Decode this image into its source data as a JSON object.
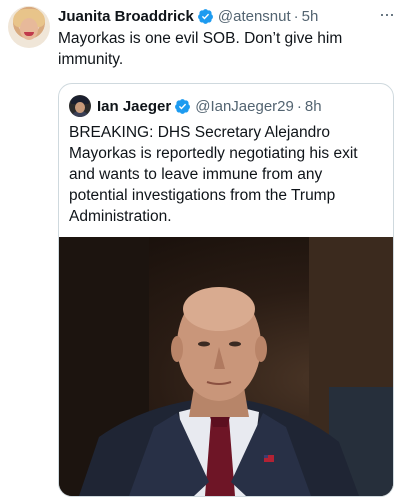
{
  "tweet": {
    "author_name": "Juanita Broaddrick",
    "author_handle": "@atensnut",
    "separator": "·",
    "time": "5h",
    "more": "···",
    "text": "Mayorkas is one evil SOB.  Don’t give him immunity.",
    "verified_color": "#1d9bf0"
  },
  "quoted_tweet": {
    "author_name": "Ian Jaeger",
    "author_handle": "@IanJaeger29",
    "separator": "·",
    "time": "8h",
    "text": "BREAKING: DHS Secretary Alejandro Mayorkas is reportedly negotiating his exit and wants to leave immune from any potential investigations from the Trump Administration."
  }
}
